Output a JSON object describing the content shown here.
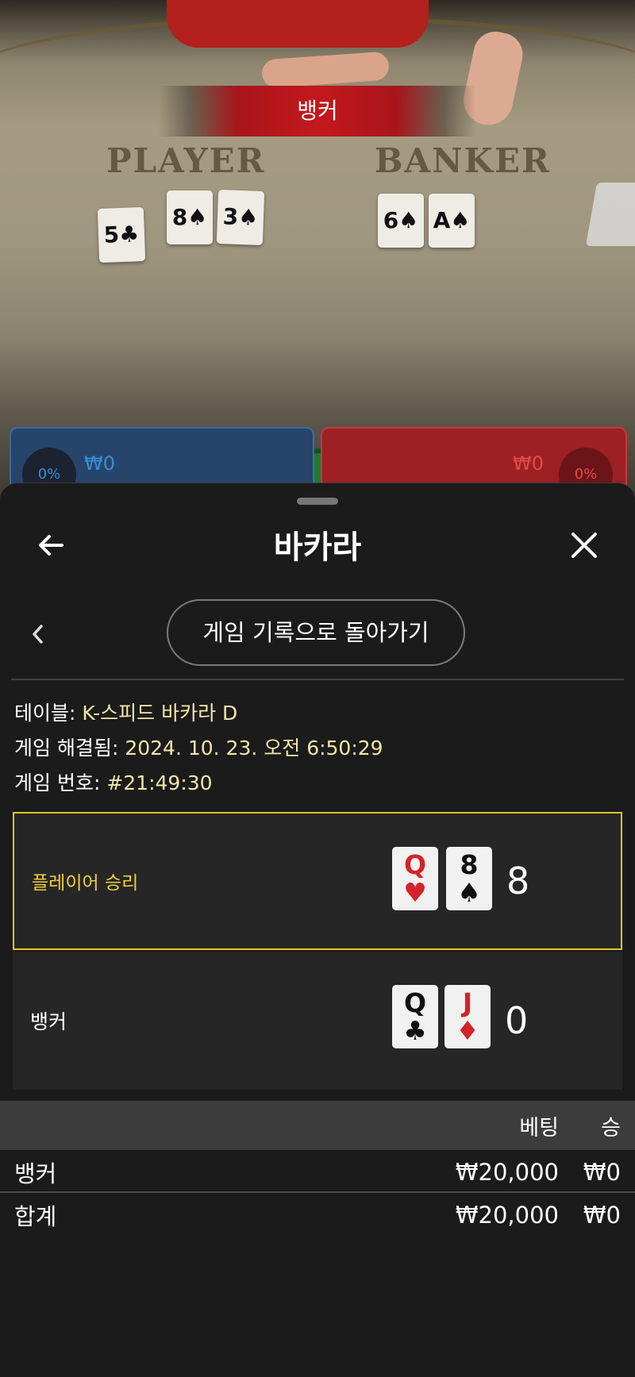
{
  "video": {
    "result_banner": "뱅커",
    "player_label": "PLAYER",
    "banker_label": "BANKER",
    "player_cards": [
      "5♣",
      "8♠",
      "3♠"
    ],
    "banker_cards": [
      "6♠",
      "A♠"
    ],
    "player_bet": {
      "percent": "0%",
      "amount": "₩0"
    },
    "banker_bet": {
      "percent": "0%",
      "amount": "₩0"
    }
  },
  "sheet": {
    "title": "바카라",
    "back_to_history": "게임 기록으로 돌아가기",
    "info": {
      "table_label": "테이블: ",
      "table_value": "K-스피드 바카라 D",
      "resolved_label": "게임 해결됨: ",
      "resolved_value": "2024. 10. 23. 오전 6:50:29",
      "number_label": "게임 번호: ",
      "number_value": "#21:49:30"
    },
    "hands": [
      {
        "label": "플레이어 승리",
        "cards": [
          {
            "rank": "Q",
            "suit": "♥",
            "color": "red"
          },
          {
            "rank": "8",
            "suit": "♠",
            "color": "black"
          }
        ],
        "total": "8",
        "winner": true
      },
      {
        "label": "뱅커",
        "cards": [
          {
            "rank": "Q",
            "suit": "♣",
            "color": "black"
          },
          {
            "rank": "J",
            "suit": "♦",
            "color": "red"
          }
        ],
        "total": "0",
        "winner": false
      }
    ],
    "table": {
      "headers": {
        "bet": "베팅",
        "win": "승"
      },
      "rows": [
        {
          "name": "뱅커",
          "bet": "₩20,000",
          "win": "₩0"
        },
        {
          "name": "합계",
          "bet": "₩20,000",
          "win": "₩0"
        }
      ]
    }
  },
  "colors": {
    "win_border": "#e2c425",
    "win_label": "#f2cf3a",
    "info_value": "#f3e6a8",
    "banner_red": "#c3181d"
  },
  "icons": {
    "back": "arrow-left-icon",
    "close": "close-icon",
    "prev": "chevron-left-icon"
  }
}
